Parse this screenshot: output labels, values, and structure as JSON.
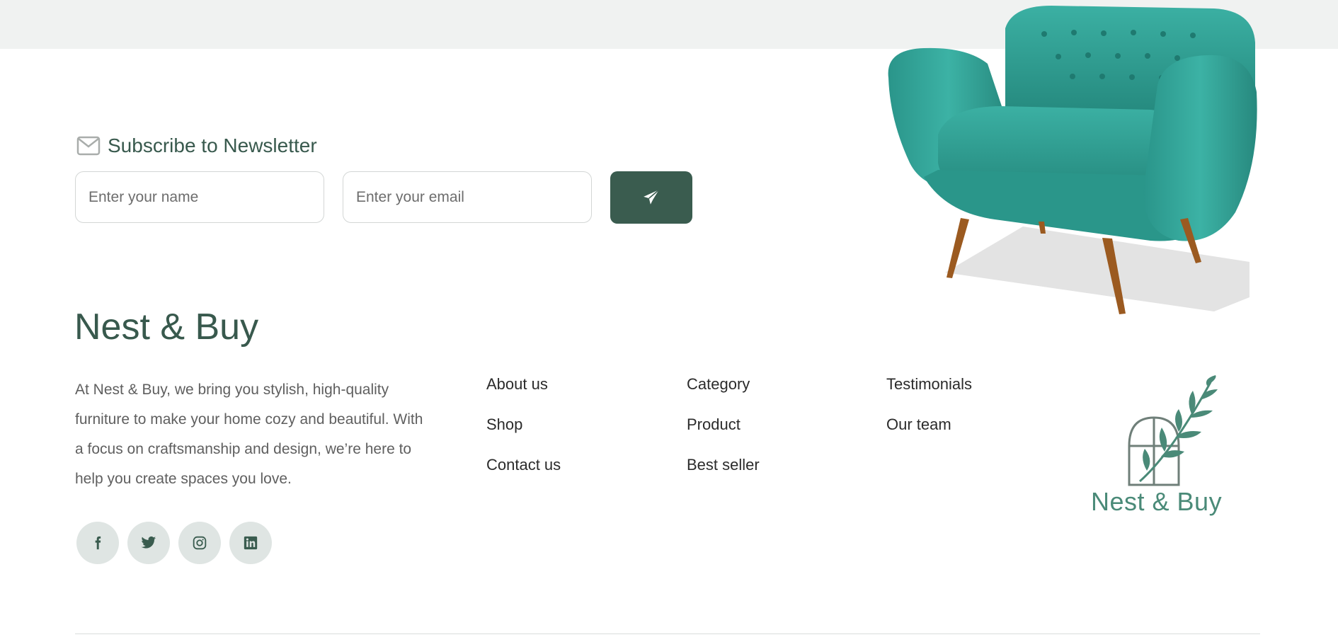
{
  "newsletter": {
    "title": "Subscribe to Newsletter",
    "name_placeholder": "Enter your name",
    "email_placeholder": "Enter your email"
  },
  "brand": {
    "name": "Nest & Buy",
    "description": "At Nest & Buy, we bring you stylish, high-quality furniture to make your home cozy and beautiful. With a focus on craftsmanship and design, we’re here to help you create spaces you love.",
    "logo_text": "Nest & Buy"
  },
  "links": {
    "col1": [
      "About us",
      "Shop",
      "Contact us"
    ],
    "col2": [
      "Category",
      "Product",
      "Best seller"
    ],
    "col3": [
      "Testimonials",
      "Our team"
    ]
  },
  "socials": [
    "facebook-icon",
    "twitter-icon",
    "instagram-icon",
    "linkedin-icon"
  ],
  "colors": {
    "accent": "#3a5c4f",
    "brand_text": "#38594d",
    "logo_green": "#4a8a78",
    "chair": "#2fa094",
    "social_bg": "#dfe5e3"
  }
}
